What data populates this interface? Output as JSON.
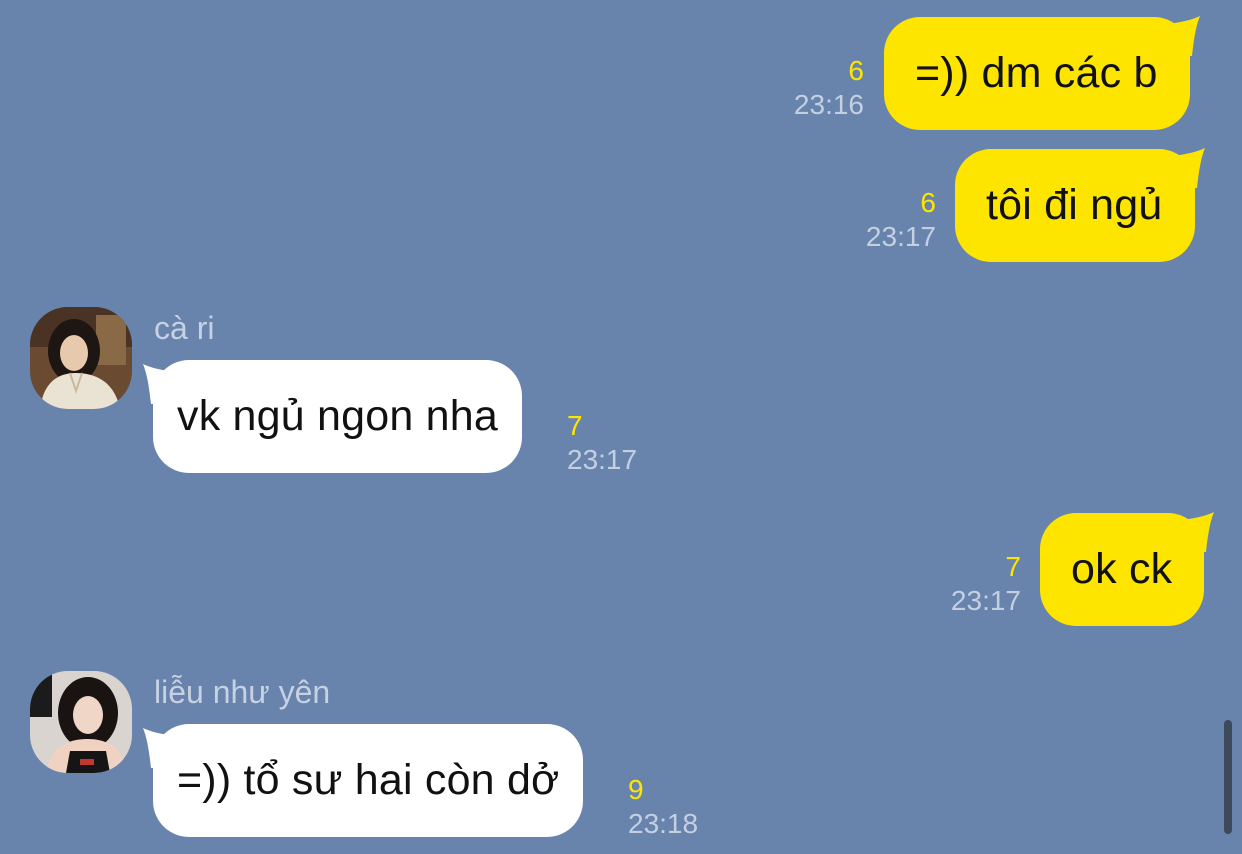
{
  "colors": {
    "background": "#6883ac",
    "outgoing_bubble": "#fee500",
    "incoming_bubble": "#ffffff",
    "unread_count": "#fee500",
    "timestamp": "#c4d0e2",
    "sender_name": "#c6d1e3"
  },
  "messages": [
    {
      "direction": "outgoing",
      "text": "=)) dm các b",
      "unread": "6",
      "time": "23:16"
    },
    {
      "direction": "outgoing",
      "text": "tôi đi ngủ",
      "unread": "6",
      "time": "23:17"
    },
    {
      "direction": "incoming",
      "sender": "cà ri",
      "avatar_icon": "profile-photo",
      "text": "vk ngủ ngon nha",
      "unread": "7",
      "time": "23:17"
    },
    {
      "direction": "outgoing",
      "text": "ok ck",
      "unread": "7",
      "time": "23:17"
    },
    {
      "direction": "incoming",
      "sender": "liễu như yên",
      "avatar_icon": "profile-photo",
      "text": "=)) tổ sư hai còn dở",
      "unread": "9",
      "time": "23:18"
    }
  ]
}
